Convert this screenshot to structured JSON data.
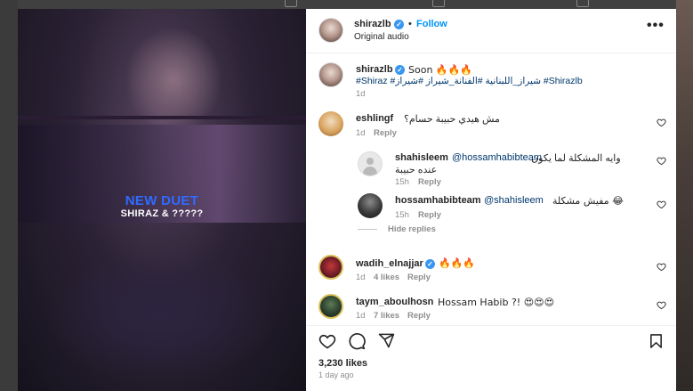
{
  "media": {
    "title": "NEW DUET",
    "subtitle": "SHIRAZ & ?????"
  },
  "header": {
    "username": "shirazlb",
    "follow_label": "Follow",
    "separator": "•",
    "audio_label": "Original audio",
    "more_icon": "more-horizontal-icon"
  },
  "caption": {
    "username": "shirazlb",
    "text": "Soon 🔥🔥🔥",
    "hashtags": "#Shiraz #شيراز_اللبنانية #الفنانة_شيراز #شيراز #Shirazlb",
    "time": "1d"
  },
  "comments": [
    {
      "username": "eshlingf",
      "text": "مش هيدي حبيبة حسام؟",
      "time": "1d",
      "reply_label": "Reply"
    },
    {
      "username": "shahisleem",
      "mention": "@hossamhabibteam",
      "text_line1": "وايه المشكلة لما يكون",
      "text_line2": "عنده حبيبة",
      "time": "15h",
      "reply_label": "Reply"
    },
    {
      "username": "hossamhabibteam",
      "mention": "@shahisleem",
      "text": "مفيش مشكلة 😂",
      "time": "15h",
      "reply_label": "Reply"
    },
    {
      "username": "wadih_elnajjar",
      "text": "🔥🔥🔥",
      "time": "1d",
      "likes": "4 likes",
      "reply_label": "Reply"
    },
    {
      "username": "taym_aboulhosn",
      "text": "Hossam Habib ?! 😍😍😍",
      "time": "1d",
      "likes": "7 likes",
      "reply_label": "Reply"
    }
  ],
  "hide_replies_label": "Hide replies",
  "post": {
    "likes": "3,230 likes",
    "posted": "1 day ago"
  },
  "colors": {
    "accent": "#0095f6",
    "duet_title": "#2f6bff",
    "verified": "#3897f0"
  }
}
